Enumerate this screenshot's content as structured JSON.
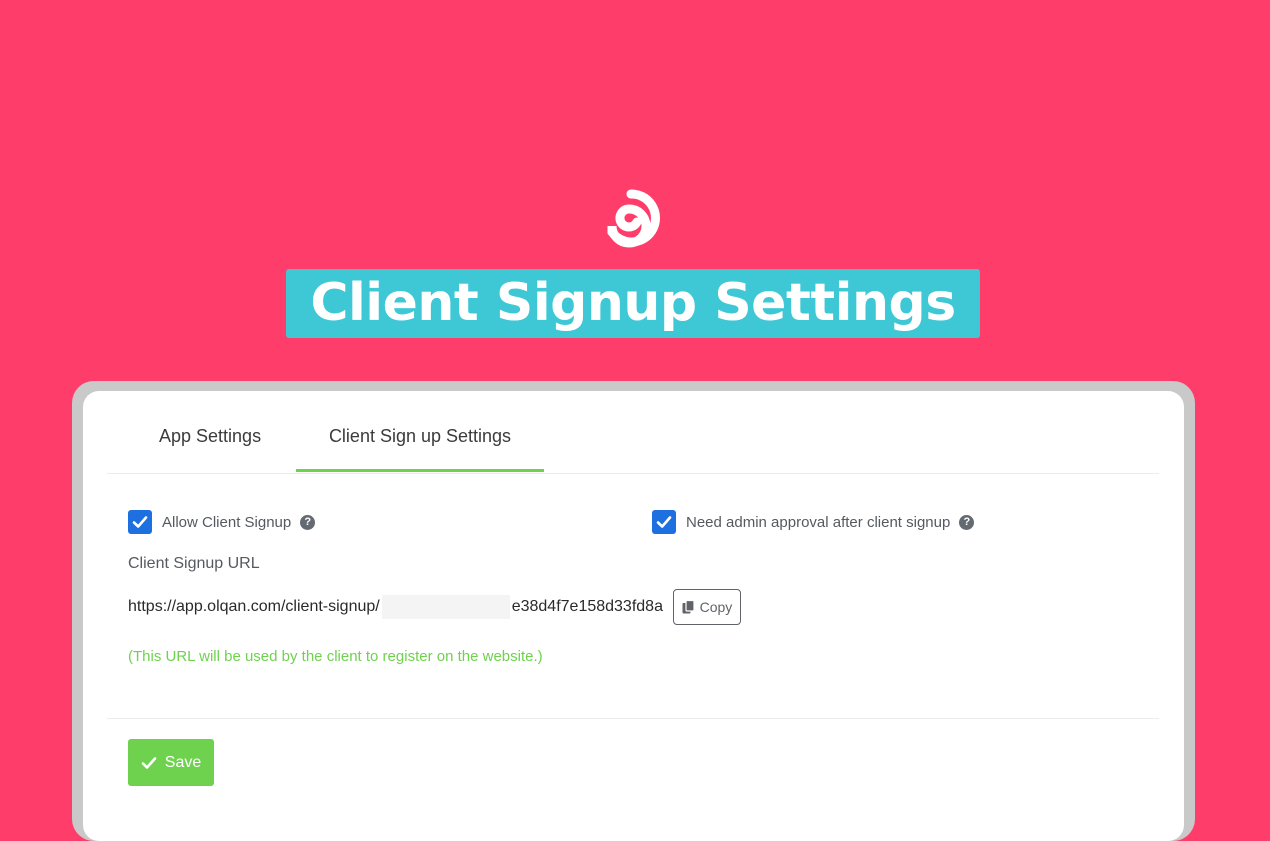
{
  "banner": {
    "title": "Client Signup Settings",
    "logo_icon": "swirl-logo-icon"
  },
  "colors": {
    "background": "#ff3d6b",
    "headline_bg": "#3ec8d6",
    "accent_green": "#6ed24f",
    "checkbox_blue": "#1e6fe0"
  },
  "tabs": [
    {
      "label": "App Settings",
      "active": false
    },
    {
      "label": "Client Sign up Settings",
      "active": true
    }
  ],
  "form": {
    "allow_signup": {
      "label": "Allow Client Signup",
      "checked": true
    },
    "admin_approval": {
      "label": "Need admin approval after client signup",
      "checked": true
    },
    "signup_url_label": "Client Signup URL",
    "signup_url_prefix": "https://app.olqan.com/client-signup/",
    "signup_url_suffix": "e38d4f7e158d33fd8a",
    "copy_label": "Copy",
    "url_note": "(This URL will be used by the client to register on the website.)",
    "save_label": "Save"
  }
}
